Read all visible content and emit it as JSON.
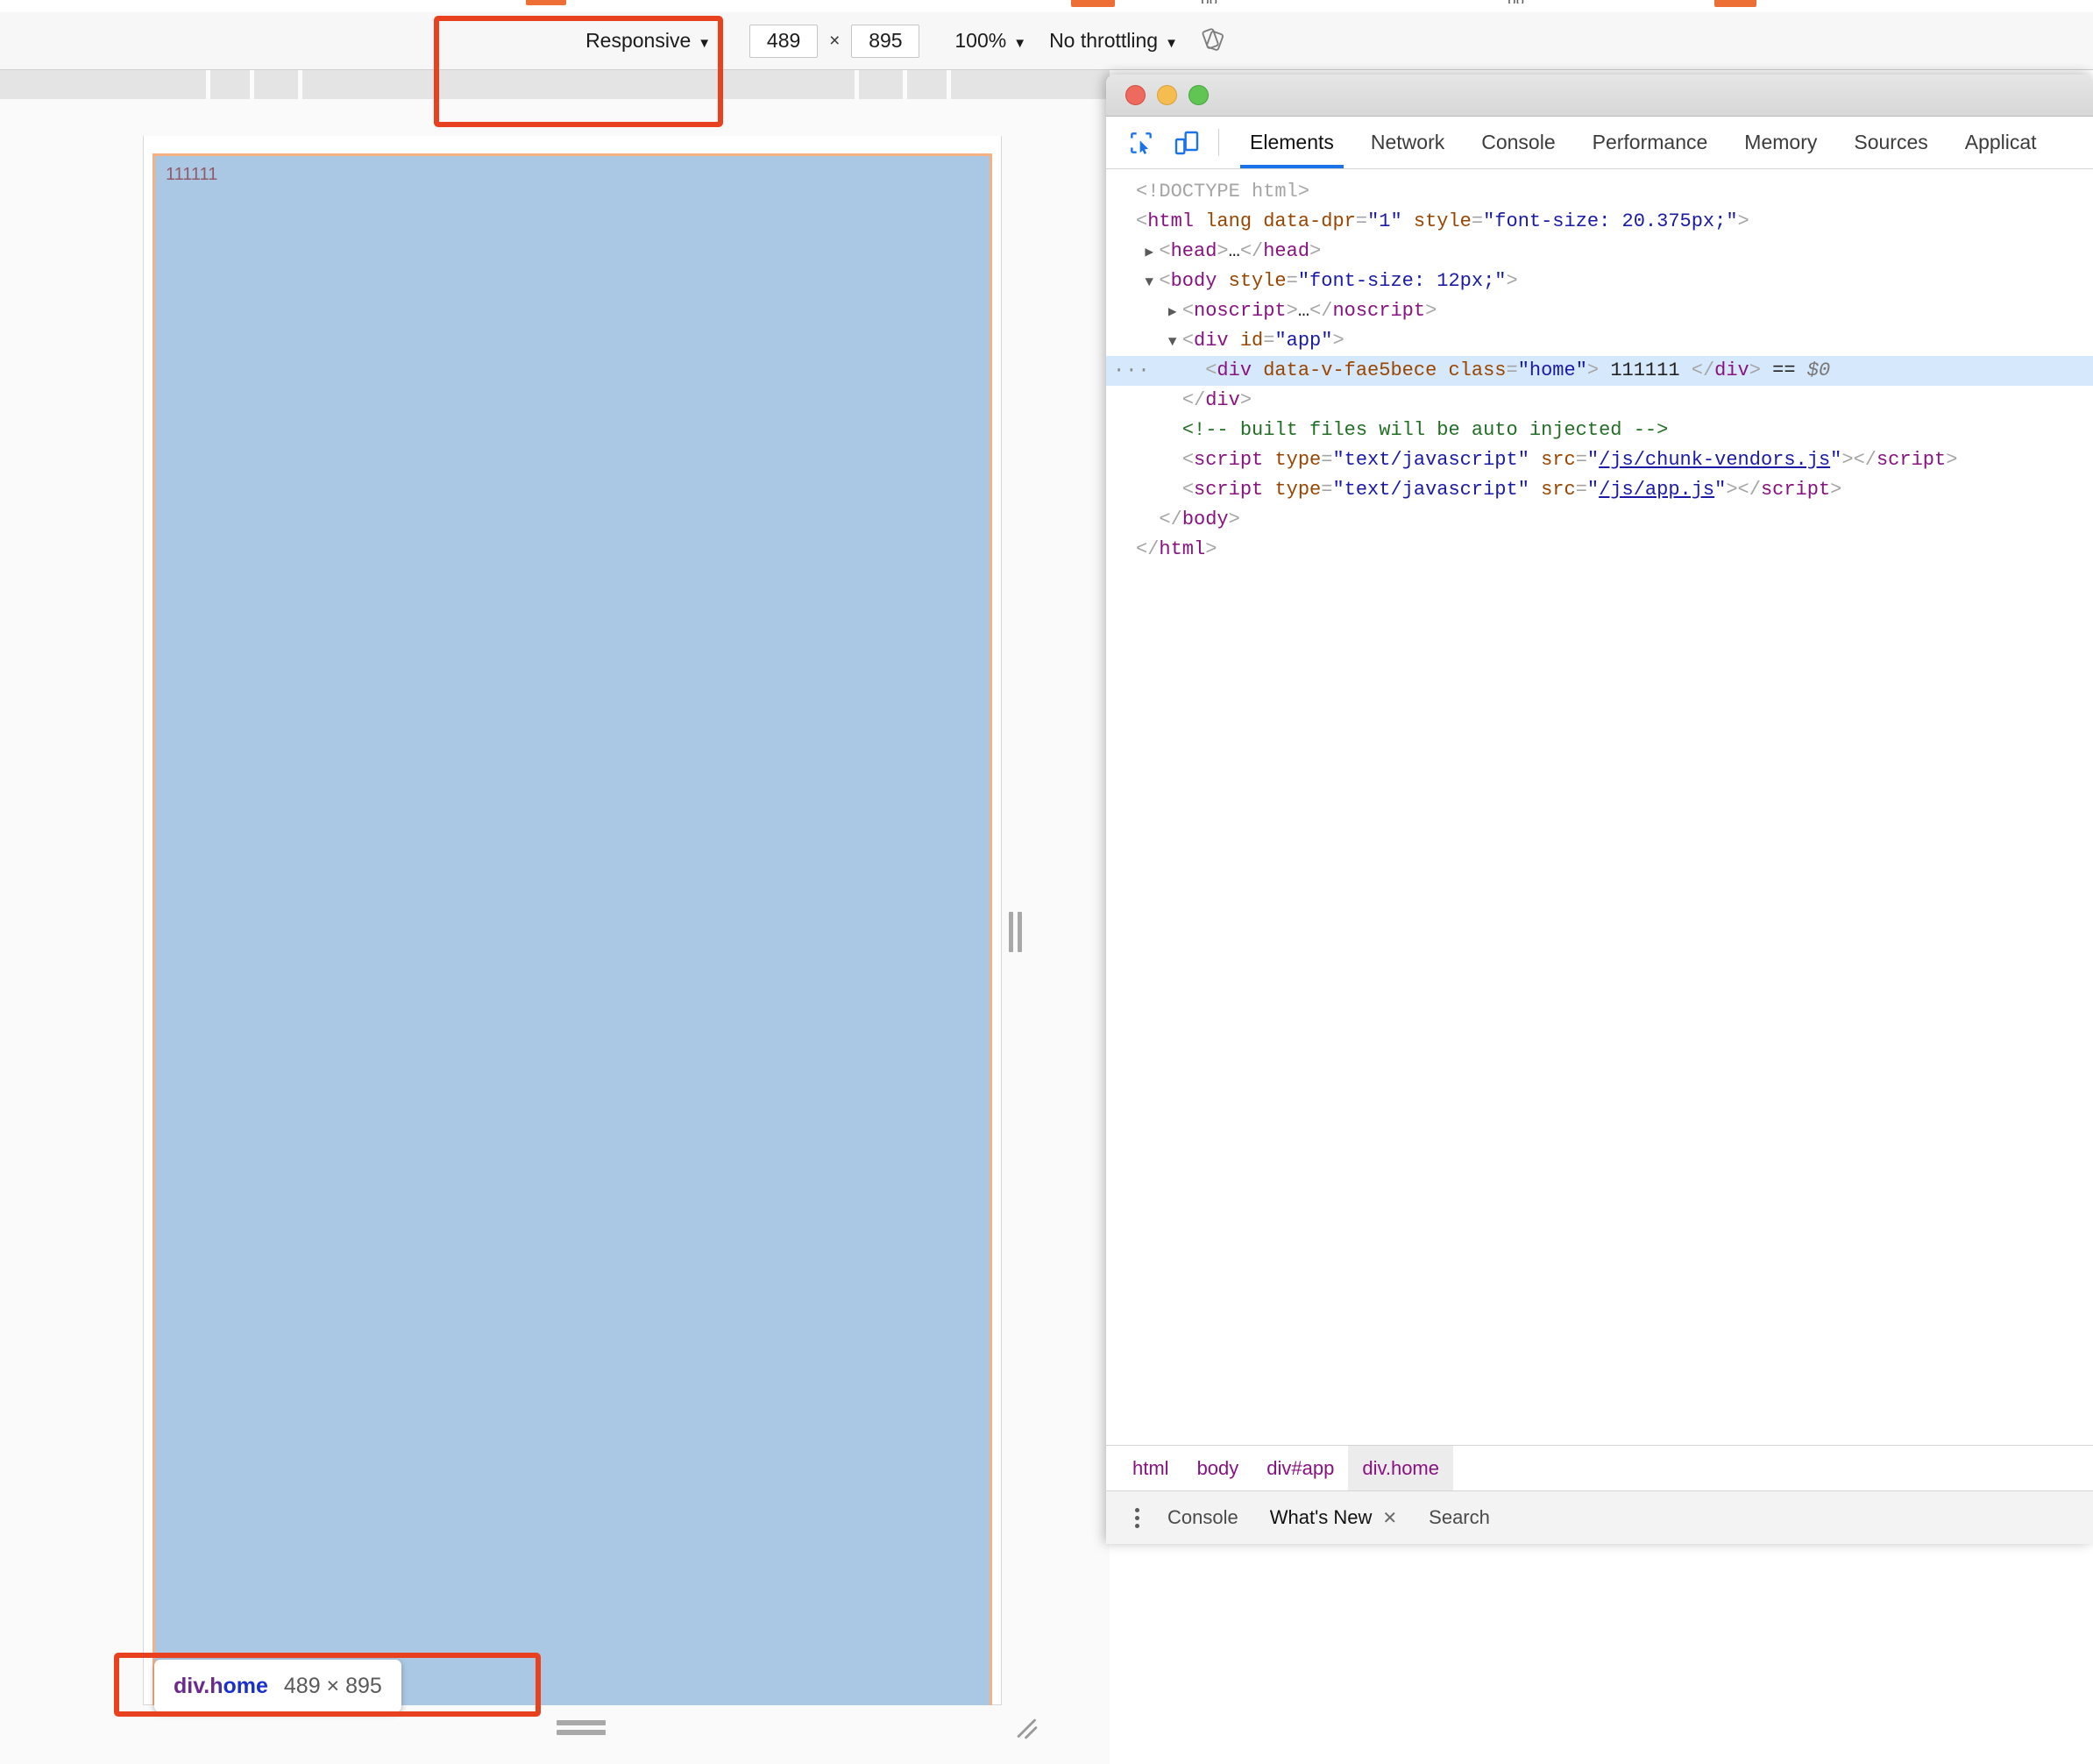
{
  "browser_strip": {
    "tab_fragments": [
      "",
      "",
      ""
    ],
    "text_fragments": [
      "pp",
      "pp"
    ]
  },
  "device_toolbar": {
    "device_label": "Responsive",
    "width_value": "489",
    "height_value": "895",
    "times_symbol": "×",
    "zoom_label": "100%",
    "throttling_label": "No throttling",
    "rotate_icon": "rotate-device-icon",
    "caret": "▼"
  },
  "viewport": {
    "highlighted_text": "111111",
    "highlight_fill": "#aac8e4",
    "highlight_border": "#f4b183"
  },
  "element_tooltip": {
    "selector": "div.home",
    "dimensions": "489 × 895"
  },
  "devtools": {
    "window_controls": [
      "close",
      "minimize",
      "maximize"
    ],
    "toolbar_icons": [
      "inspect-element-icon",
      "device-toolbar-icon"
    ],
    "tabs": [
      {
        "label": "Elements",
        "active": true
      },
      {
        "label": "Network",
        "active": false
      },
      {
        "label": "Console",
        "active": false
      },
      {
        "label": "Performance",
        "active": false
      },
      {
        "label": "Memory",
        "active": false
      },
      {
        "label": "Sources",
        "active": false
      },
      {
        "label": "Applicat",
        "active": false
      }
    ],
    "code_lines": [
      {
        "id": "doctype",
        "indent": 0,
        "segments": [
          {
            "c": "pn",
            "t": "<!DOCTYPE html>"
          }
        ]
      },
      {
        "id": "html-open",
        "indent": 0,
        "segments": [
          {
            "c": "pn",
            "t": "<"
          },
          {
            "c": "tw",
            "t": "html"
          },
          {
            "c": "tx",
            "t": " "
          },
          {
            "c": "at",
            "t": "lang"
          },
          {
            "c": "tx",
            "t": " "
          },
          {
            "c": "at",
            "t": "data-dpr"
          },
          {
            "c": "pn",
            "t": "="
          },
          {
            "c": "av",
            "t": "\"1\""
          },
          {
            "c": "tx",
            "t": " "
          },
          {
            "c": "at",
            "t": "style"
          },
          {
            "c": "pn",
            "t": "="
          },
          {
            "c": "av",
            "t": "\"font-size: 20.375px;\""
          },
          {
            "c": "pn",
            "t": ">"
          }
        ]
      },
      {
        "id": "head",
        "indent": 1,
        "arrow": "▶",
        "segments": [
          {
            "c": "pn",
            "t": "<"
          },
          {
            "c": "tw",
            "t": "head"
          },
          {
            "c": "pn",
            "t": ">"
          },
          {
            "c": "tx",
            "t": "…"
          },
          {
            "c": "pn",
            "t": "</"
          },
          {
            "c": "tw",
            "t": "head"
          },
          {
            "c": "pn",
            "t": ">"
          }
        ]
      },
      {
        "id": "body-open",
        "indent": 1,
        "arrow": "▼",
        "segments": [
          {
            "c": "pn",
            "t": "<"
          },
          {
            "c": "tw",
            "t": "body"
          },
          {
            "c": "tx",
            "t": " "
          },
          {
            "c": "at",
            "t": "style"
          },
          {
            "c": "pn",
            "t": "="
          },
          {
            "c": "av",
            "t": "\"font-size: 12px;\""
          },
          {
            "c": "pn",
            "t": ">"
          }
        ]
      },
      {
        "id": "noscript",
        "indent": 2,
        "arrow": "▶",
        "segments": [
          {
            "c": "pn",
            "t": "<"
          },
          {
            "c": "tw",
            "t": "noscript"
          },
          {
            "c": "pn",
            "t": ">"
          },
          {
            "c": "tx",
            "t": "…"
          },
          {
            "c": "pn",
            "t": "</"
          },
          {
            "c": "tw",
            "t": "noscript"
          },
          {
            "c": "pn",
            "t": ">"
          }
        ]
      },
      {
        "id": "div-app",
        "indent": 2,
        "arrow": "▼",
        "segments": [
          {
            "c": "pn",
            "t": "<"
          },
          {
            "c": "tw",
            "t": "div"
          },
          {
            "c": "tx",
            "t": " "
          },
          {
            "c": "at",
            "t": "id"
          },
          {
            "c": "pn",
            "t": "="
          },
          {
            "c": "av",
            "t": "\"app\""
          },
          {
            "c": "pn",
            "t": ">"
          }
        ]
      },
      {
        "id": "div-home",
        "indent": 3,
        "selected": true,
        "dots": "···",
        "segments": [
          {
            "c": "pn",
            "t": "<"
          },
          {
            "c": "tw",
            "t": "div"
          },
          {
            "c": "tx",
            "t": " "
          },
          {
            "c": "at",
            "t": "data-v-fae5bece"
          },
          {
            "c": "tx",
            "t": " "
          },
          {
            "c": "at",
            "t": "class"
          },
          {
            "c": "pn",
            "t": "="
          },
          {
            "c": "av",
            "t": "\"home\""
          },
          {
            "c": "pn",
            "t": "> "
          },
          {
            "c": "tx",
            "t": "111111"
          },
          {
            "c": "pn",
            "t": " </"
          },
          {
            "c": "tw",
            "t": "div"
          },
          {
            "c": "pn",
            "t": ">"
          },
          {
            "c": "eq",
            "t": " == "
          },
          {
            "c": "dollar",
            "t": "$0"
          }
        ]
      },
      {
        "id": "div-app-close",
        "indent": 2,
        "segments": [
          {
            "c": "pn",
            "t": "</"
          },
          {
            "c": "tw",
            "t": "div"
          },
          {
            "c": "pn",
            "t": ">"
          }
        ]
      },
      {
        "id": "comment",
        "indent": 2,
        "segments": [
          {
            "c": "cm",
            "t": "<!-- built files will be auto injected -->"
          }
        ]
      },
      {
        "id": "script-vendors",
        "indent": 2,
        "segments": [
          {
            "c": "pn",
            "t": "<"
          },
          {
            "c": "tw",
            "t": "script"
          },
          {
            "c": "tx",
            "t": " "
          },
          {
            "c": "at",
            "t": "type"
          },
          {
            "c": "pn",
            "t": "="
          },
          {
            "c": "av",
            "t": "\"text/javascript\""
          },
          {
            "c": "tx",
            "t": " "
          },
          {
            "c": "at",
            "t": "src"
          },
          {
            "c": "pn",
            "t": "="
          },
          {
            "c": "av",
            "t": "\""
          },
          {
            "c": "lk",
            "t": "/js/chunk-vendors.js"
          },
          {
            "c": "av",
            "t": "\""
          },
          {
            "c": "pn",
            "t": ">"
          },
          {
            "c": "pn",
            "t": "</"
          },
          {
            "c": "tw",
            "t": "script"
          },
          {
            "c": "pn",
            "t": ">"
          }
        ]
      },
      {
        "id": "script-app",
        "indent": 2,
        "segments": [
          {
            "c": "pn",
            "t": "<"
          },
          {
            "c": "tw",
            "t": "script"
          },
          {
            "c": "tx",
            "t": " "
          },
          {
            "c": "at",
            "t": "type"
          },
          {
            "c": "pn",
            "t": "="
          },
          {
            "c": "av",
            "t": "\"text/javascript\""
          },
          {
            "c": "tx",
            "t": " "
          },
          {
            "c": "at",
            "t": "src"
          },
          {
            "c": "pn",
            "t": "="
          },
          {
            "c": "av",
            "t": "\""
          },
          {
            "c": "lk",
            "t": "/js/app.js"
          },
          {
            "c": "av",
            "t": "\""
          },
          {
            "c": "pn",
            "t": ">"
          },
          {
            "c": "pn",
            "t": "</"
          },
          {
            "c": "tw",
            "t": "script"
          },
          {
            "c": "pn",
            "t": ">"
          }
        ]
      },
      {
        "id": "body-close",
        "indent": 1,
        "segments": [
          {
            "c": "pn",
            "t": "</"
          },
          {
            "c": "tw",
            "t": "body"
          },
          {
            "c": "pn",
            "t": ">"
          }
        ]
      },
      {
        "id": "html-close",
        "indent": 0,
        "segments": [
          {
            "c": "pn",
            "t": "</"
          },
          {
            "c": "tw",
            "t": "html"
          },
          {
            "c": "pn",
            "t": ">"
          }
        ]
      }
    ],
    "breadcrumbs": [
      {
        "label": "html",
        "active": false
      },
      {
        "label": "body",
        "active": false
      },
      {
        "label": "div#app",
        "active": false
      },
      {
        "label": "div.home",
        "active": true
      }
    ],
    "drawer_tabs": [
      {
        "label": "Console",
        "active": false,
        "closable": false
      },
      {
        "label": "What's New",
        "active": true,
        "closable": true
      },
      {
        "label": "Search",
        "active": false,
        "closable": false
      }
    ],
    "drawer_close_glyph": "✕"
  },
  "annotations": {
    "accent_color": "#e8411f",
    "top_label": "size-controls-highlight",
    "bottom_label": "element-tooltip-highlight"
  }
}
